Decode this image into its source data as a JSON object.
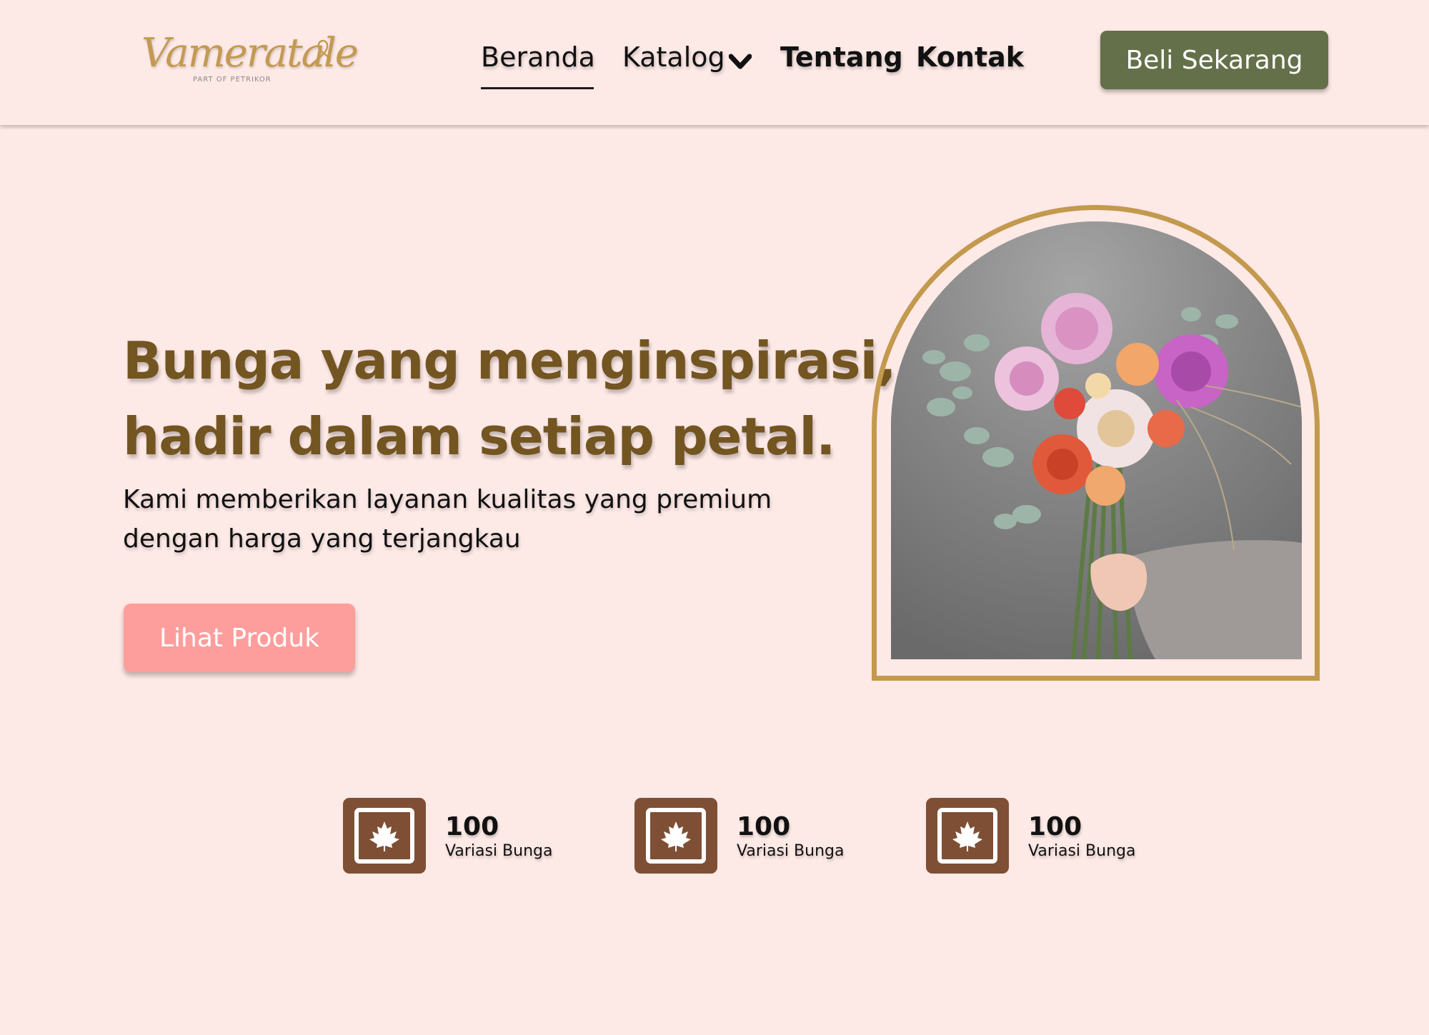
{
  "brand": {
    "logo_text": "Vameratale",
    "logo_sub": "PART OF PETRIKOR"
  },
  "nav": {
    "items": [
      {
        "label": "Beranda"
      },
      {
        "label": "Katalog"
      },
      {
        "label": "Tentang"
      },
      {
        "label": "Kontak"
      }
    ],
    "active": "Beranda",
    "cta_label": "Beli Sekarang"
  },
  "hero": {
    "title_line1": "Bunga yang menginspirasi,",
    "title_line2": "hadir dalam setiap petal.",
    "desc_line1": "Kami memberikan layanan kualitas yang premium",
    "desc_line2": "dengan harga yang terjangkau",
    "button_label": "Lihat Produk"
  },
  "stats": [
    {
      "number": "100",
      "label": "Variasi Bunga",
      "icon": "maple-leaf-icon"
    },
    {
      "number": "100",
      "label": "Variasi Bunga",
      "icon": "maple-leaf-icon"
    },
    {
      "number": "100",
      "label": "Variasi Bunga",
      "icon": "maple-leaf-icon"
    }
  ],
  "colors": {
    "background": "#fde9e6",
    "cta_green": "#647049",
    "title_brown": "#735521",
    "button_pink": "#fe9e9c",
    "icon_brown": "#7f4f35",
    "frame_gold": "#c3994e"
  }
}
